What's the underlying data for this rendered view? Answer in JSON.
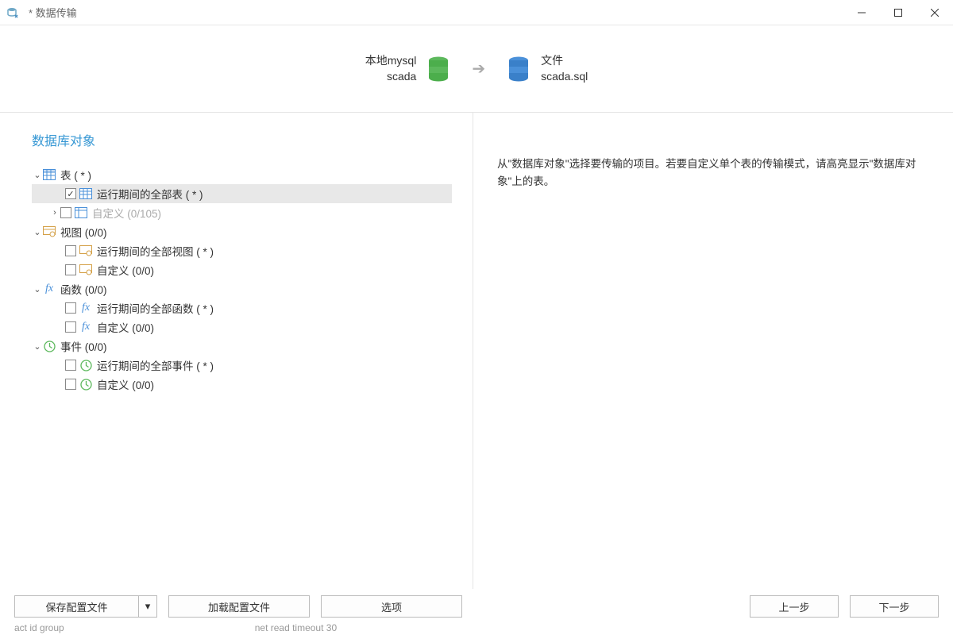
{
  "window": {
    "title": "* 数据传输"
  },
  "header": {
    "source_line1": "本地mysql",
    "source_line2": "scada",
    "dest_line1": "文件",
    "dest_line2": "scada.sql"
  },
  "section_title": "数据库对象",
  "tree": {
    "tables": {
      "label": "表 ( * )",
      "all_label": "运行期间的全部表 ( * )",
      "custom_label": "自定义 (0/105)"
    },
    "views": {
      "label": "视图 (0/0)",
      "all_label": "运行期间的全部视图 ( * )",
      "custom_label": "自定义 (0/0)"
    },
    "functions": {
      "label": "函数 (0/0)",
      "all_label": "运行期间的全部函数 ( * )",
      "custom_label": "自定义 (0/0)"
    },
    "events": {
      "label": "事件 (0/0)",
      "all_label": "运行期间的全部事件 ( * )",
      "custom_label": "自定义 (0/0)"
    }
  },
  "hint": "从\"数据库对象\"选择要传输的项目。若要自定义单个表的传输模式，请高亮显示\"数据库对象\"上的表。",
  "footer": {
    "save": "保存配置文件",
    "load": "加载配置文件",
    "options": "选项",
    "prev": "上一步",
    "next": "下一步"
  },
  "garbage": {
    "g1": "act id group",
    "g2": "net read timeout     30"
  }
}
